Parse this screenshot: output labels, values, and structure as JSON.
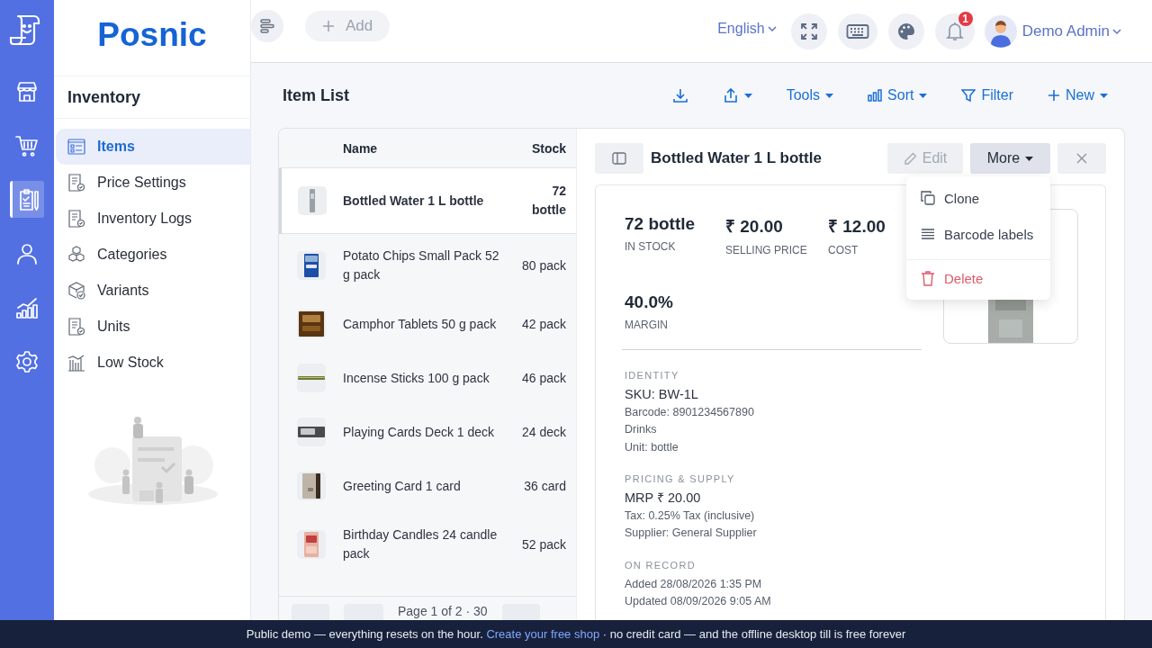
{
  "brand": "Posnic",
  "rail": [
    {
      "kind": "store",
      "selected": false
    },
    {
      "kind": "cart",
      "selected": false
    },
    {
      "kind": "clipboard",
      "selected": true
    },
    {
      "kind": "user",
      "selected": false
    },
    {
      "kind": "chart",
      "selected": false
    },
    {
      "kind": "settings",
      "selected": false
    }
  ],
  "sidebar": {
    "title": "Inventory",
    "items": [
      {
        "label": "Items",
        "kind": "list",
        "selected": true
      },
      {
        "label": "Price Settings",
        "kind": "doc",
        "selected": false
      },
      {
        "label": "Inventory Logs",
        "kind": "doc",
        "selected": false
      },
      {
        "label": "Categories",
        "kind": "cubes",
        "selected": false
      },
      {
        "label": "Variants",
        "kind": "box",
        "selected": false
      },
      {
        "label": "Units",
        "kind": "doc",
        "selected": false
      },
      {
        "label": "Low Stock",
        "kind": "bars",
        "selected": false
      }
    ]
  },
  "topbar": {
    "add_label": "Add",
    "language": "English",
    "notification_count": "1",
    "user": "Demo Admin"
  },
  "page": {
    "title": "Item List",
    "toolbar": [
      {
        "kind": "download",
        "dropdown": false
      },
      {
        "kind": "upload",
        "dropdown": true
      },
      {
        "kind": "tools",
        "label": "Tools",
        "dropdown": true
      },
      {
        "kind": "sort",
        "label": "Sort",
        "dropdown": true
      },
      {
        "kind": "filter",
        "label": "Filter",
        "dropdown": false
      },
      {
        "kind": "new",
        "label": "New",
        "dropdown": true
      }
    ]
  },
  "table": {
    "columns": [
      "Name",
      "Stock"
    ],
    "rows": [
      {
        "name": "Bottled Water 1 L bottle",
        "stock": "72 bottle",
        "selected": true
      },
      {
        "name": "Potato Chips Small Pack 52 g pack",
        "stock": "80 pack",
        "selected": false
      },
      {
        "name": "Camphor Tablets 50 g pack",
        "stock": "42 pack",
        "selected": false
      },
      {
        "name": "Incense Sticks 100 g pack",
        "stock": "46 pack",
        "selected": false
      },
      {
        "name": "Playing Cards Deck 1 deck",
        "stock": "24 deck",
        "selected": false
      },
      {
        "name": "Greeting Card 1 card",
        "stock": "36 card",
        "selected": false
      },
      {
        "name": "Birthday Candles 24 candle pack",
        "stock": "52 pack",
        "selected": false
      }
    ],
    "pagination": "Page 1 of 2 · 30"
  },
  "detail": {
    "title": "Bottled Water 1 L bottle",
    "edit": {
      "label": "Edit",
      "disabled": true
    },
    "more": {
      "label": "More",
      "expanded": true
    },
    "menu": [
      {
        "label": "Clone",
        "kind": "clone"
      },
      {
        "label": "Barcode labels",
        "kind": "barcode"
      },
      {
        "label": "Delete",
        "kind": "delete"
      }
    ],
    "stats": [
      {
        "value": "72 bottle",
        "label": "IN STOCK"
      },
      {
        "value": "₹ 20.00",
        "label": "SELLING PRICE"
      },
      {
        "value": "₹ 12.00",
        "label": "COST"
      },
      {
        "value": "40.0%",
        "label": "MARGIN"
      }
    ],
    "sections": [
      {
        "title": "IDENTITY",
        "lines": [
          {
            "text": "SKU: BW-1L",
            "emphasis": true
          },
          {
            "text": "Barcode: 8901234567890",
            "emphasis": false
          },
          {
            "text": "Drinks",
            "emphasis": false
          },
          {
            "text": "Unit: bottle",
            "emphasis": false
          }
        ]
      },
      {
        "title": "PRICING & SUPPLY",
        "lines": [
          {
            "text": "MRP ₹ 20.00",
            "emphasis": true
          },
          {
            "text": "Tax: 0.25% Tax (inclusive)",
            "emphasis": false
          },
          {
            "text": "Supplier: General Supplier",
            "emphasis": false
          }
        ]
      },
      {
        "title": "ON RECORD",
        "lines": [
          {
            "text": "Added 28/08/2026 1:35 PM",
            "emphasis": false
          },
          {
            "text": "Updated 08/09/2026 9:05 AM",
            "emphasis": false
          }
        ]
      }
    ]
  },
  "banner": {
    "before": "Public demo — everything resets on the hour.",
    "link": "Create your free shop",
    "after": "· no credit card — and the offline desktop till is free forever"
  }
}
